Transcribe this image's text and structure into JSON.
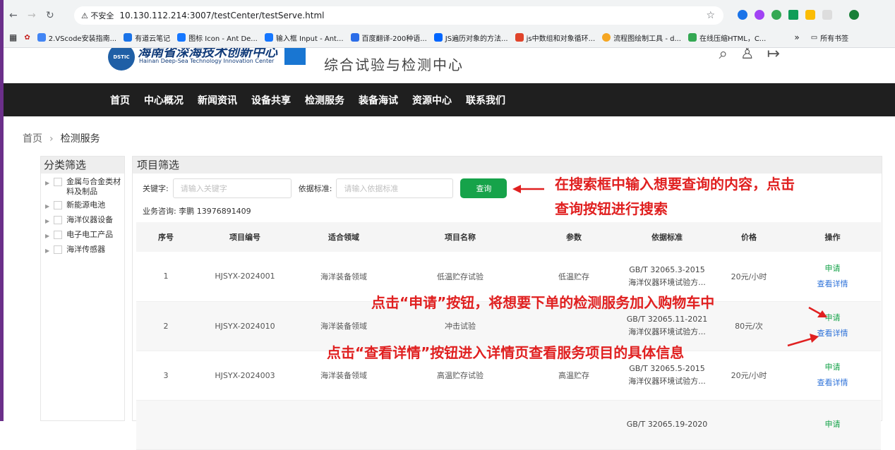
{
  "browser": {
    "insecure_label": "不安全",
    "url": "10.130.112.214:3007/testCenter/testServe.html",
    "bookmarks": [
      "2.VScode安装指南...",
      "有道云笔记",
      "图标 Icon - Ant De...",
      "输入框 Input - Ant...",
      "百度翻译-200种语...",
      "JS遍历对象的方法...",
      "js中数组和对象循环...",
      "流程图绘制工具 - d...",
      "在线压缩HTML，C..."
    ],
    "bookmarks_more": "»",
    "all_bookmarks": "所有书签"
  },
  "header": {
    "logo_badge": "DSTIC",
    "logo_cn": "海南省深海技术创新中心",
    "logo_en": "Hainan Deep-Sea Technology Innovation Center",
    "center_title": "综合试验与检测中心"
  },
  "nav": [
    "首页",
    "中心概况",
    "新闻资讯",
    "设备共享",
    "检测服务",
    "装备海试",
    "资源中心",
    "联系我们"
  ],
  "breadcrumb": {
    "home": "首页",
    "current": "检测服务"
  },
  "category": {
    "title": "分类筛选",
    "items": [
      "金属与合金类材料及制品",
      "新能源电池",
      "海洋仪器设备",
      "电子电工产品",
      "海洋传感器"
    ]
  },
  "projects": {
    "title": "项目筛选",
    "keyword_label": "关键字:",
    "keyword_placeholder": "请输入关键字",
    "standard_label": "依据标准:",
    "standard_placeholder": "请输入依据标准",
    "query_button": "查询",
    "consult": "业务咨询: 李鹏 13976891409",
    "columns": [
      "序号",
      "项目编号",
      "适合领域",
      "项目名称",
      "参数",
      "依据标准",
      "价格",
      "操作"
    ],
    "rows": [
      {
        "no": "1",
        "code": "HJSYX-2024001",
        "field": "海洋装备领域",
        "name": "低温贮存试验",
        "param": "低温贮存",
        "std1": "GB/T 32065.3-2015",
        "std2": "海洋仪器环境试验方...",
        "price": "20元/小时"
      },
      {
        "no": "2",
        "code": "HJSYX-2024010",
        "field": "海洋装备领域",
        "name": "冲击试验",
        "param": "",
        "std1": "GB/T 32065.11-2021",
        "std2": "海洋仪器环境试验方...",
        "price": "80元/次"
      },
      {
        "no": "3",
        "code": "HJSYX-2024003",
        "field": "海洋装备领域",
        "name": "高温贮存试验",
        "param": "高温贮存",
        "std1": "GB/T 32065.5-2015",
        "std2": "海洋仪器环境试验方...",
        "price": "20元/小时"
      },
      {
        "no": "",
        "code": "",
        "field": "",
        "name": "",
        "param": "",
        "std1": "GB/T 32065.19-2020",
        "std2": "",
        "price": ""
      }
    ],
    "apply": "申请",
    "detail": "查看详情"
  },
  "annotations": {
    "search_line1": "在搜索框中输入想要查询的内容，点击",
    "search_line2": "查询按钮进行搜索",
    "apply_note": "点击“申请”按钮，将想要下单的检测服务加入购物车中",
    "detail_note": "点击“查看详情”按钮进入详情页查看服务项目的具体信息"
  },
  "colors": {
    "accent_green": "#16a34a",
    "annotation_red": "#e02020",
    "nav_bg": "#1f1f1f",
    "link_blue": "#2f73d9"
  }
}
